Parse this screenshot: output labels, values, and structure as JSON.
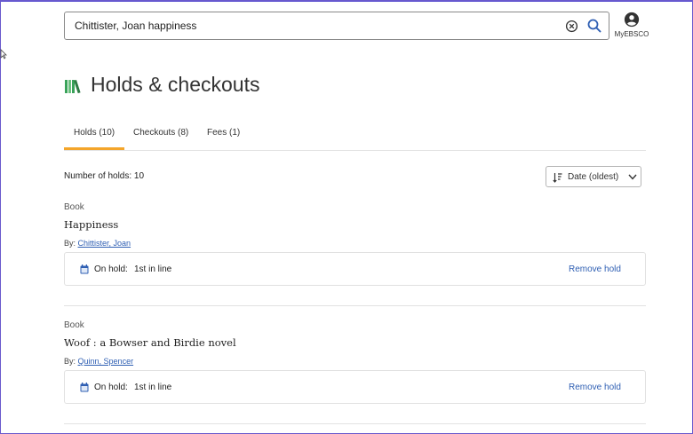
{
  "search": {
    "query": "Chittister, Joan happiness"
  },
  "account": {
    "label": "MyEBSCO"
  },
  "page": {
    "title": "Holds & checkouts"
  },
  "tabs": [
    {
      "label": "Holds (10)",
      "active": true
    },
    {
      "label": "Checkouts (8)",
      "active": false
    },
    {
      "label": "Fees (1)",
      "active": false
    }
  ],
  "holds_summary": "Number of holds: 10",
  "sort": {
    "selected": "Date (oldest)"
  },
  "holds": [
    {
      "type": "Book",
      "title": "Happiness",
      "by_label": "By:",
      "author": "Chittister, Joan",
      "status_label": "On hold:",
      "status_value": "1st in line",
      "action": "Remove hold"
    },
    {
      "type": "Book",
      "title": "Woof : a Bowser and Birdie novel",
      "by_label": "By:",
      "author": "Quinn, Spencer",
      "status_label": "On hold:",
      "status_value": "1st in line",
      "action": "Remove hold"
    }
  ],
  "colors": {
    "accent_tab": "#f4a52a",
    "link": "#2f5fb3",
    "search_icon": "#2f5fb3",
    "books_icon": "#3aa35a",
    "calendar_icon": "#2f5fb3"
  },
  "icons": [
    "clear-search-icon",
    "search-icon",
    "account-icon",
    "books-icon",
    "sort-icon",
    "chevron-down-icon",
    "calendar-icon"
  ]
}
